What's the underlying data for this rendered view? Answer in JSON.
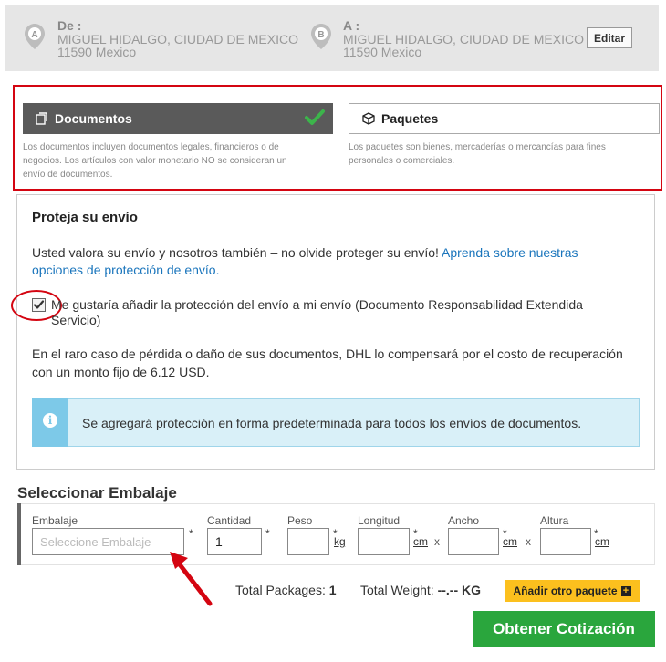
{
  "origin": {
    "label": "De :",
    "line1": "MIGUEL HIDALGO, CIUDAD DE MEXICO",
    "line2": "11590 Mexico",
    "pin_letter": "A"
  },
  "destination": {
    "label": "A :",
    "line1": "MIGUEL HIDALGO, CIUDAD DE MEXICO",
    "line2": "11590 Mexico",
    "pin_letter": "B"
  },
  "edit_label": "Editar",
  "shipment_type": {
    "documents": {
      "label": "Documentos",
      "selected": true,
      "desc1": "Los documentos incluyen documentos legales, financieros o de",
      "desc2": "negocios. Los artículos con valor monetario NO se consideran un",
      "desc3": "envío de documentos."
    },
    "packages": {
      "label": "Paquetes",
      "selected": false,
      "desc1": "Los paquetes son bienes, mercaderías o mercancías para fines",
      "desc2": "personales o comerciales."
    }
  },
  "protection": {
    "title": "Proteja su envío",
    "intro_text": "Usted valora su envío y nosotros también – no olvide proteger su envío! ",
    "intro_link_a": "Aprenda sobre nuestras",
    "intro_link_b": "opciones de protección de envío.",
    "checkbox_checked": true,
    "checkbox_label_1": "Me gustaría añadir la protección del envío a mi envío (Documento Responsabilidad Extendida",
    "checkbox_label_2": "Servicio)",
    "loss_text_1": "En el raro caso de pérdida o daño de sus documentos, DHL lo compensará por el costo de recuperación",
    "loss_text_2": "con un monto fijo de 6.12 USD.",
    "info_icon_glyph": "i",
    "info_text": "Se agregará protección en forma predeterminada para todos los envíos de documentos."
  },
  "packaging": {
    "title": "Seleccionar Embalaje",
    "embalaje_label": "Embalaje",
    "embalaje_placeholder": "Seleccione Embalaje",
    "cantidad_label": "Cantidad",
    "cantidad_value": "1",
    "peso_label": "Peso",
    "peso_unit": "kg",
    "longitud_label": "Longitud",
    "ancho_label": "Ancho",
    "altura_label": "Altura",
    "cm_unit": "cm",
    "required_mark": "*",
    "dim_separator": "x"
  },
  "totals": {
    "packages_label": "Total Packages:",
    "packages_value": "1",
    "weight_label": "Total Weight:",
    "weight_value": "--.-- KG"
  },
  "add_package_label": "Añadir otro paquete",
  "add_package_icon": "+",
  "quote_label": "Obtener Cotización",
  "colors": {
    "dhl_red": "#d40511",
    "dhl_yellow": "#fcc01e",
    "quote_green": "#2aa63d",
    "link_blue": "#1a75bc",
    "check_green": "#3cb44b"
  }
}
